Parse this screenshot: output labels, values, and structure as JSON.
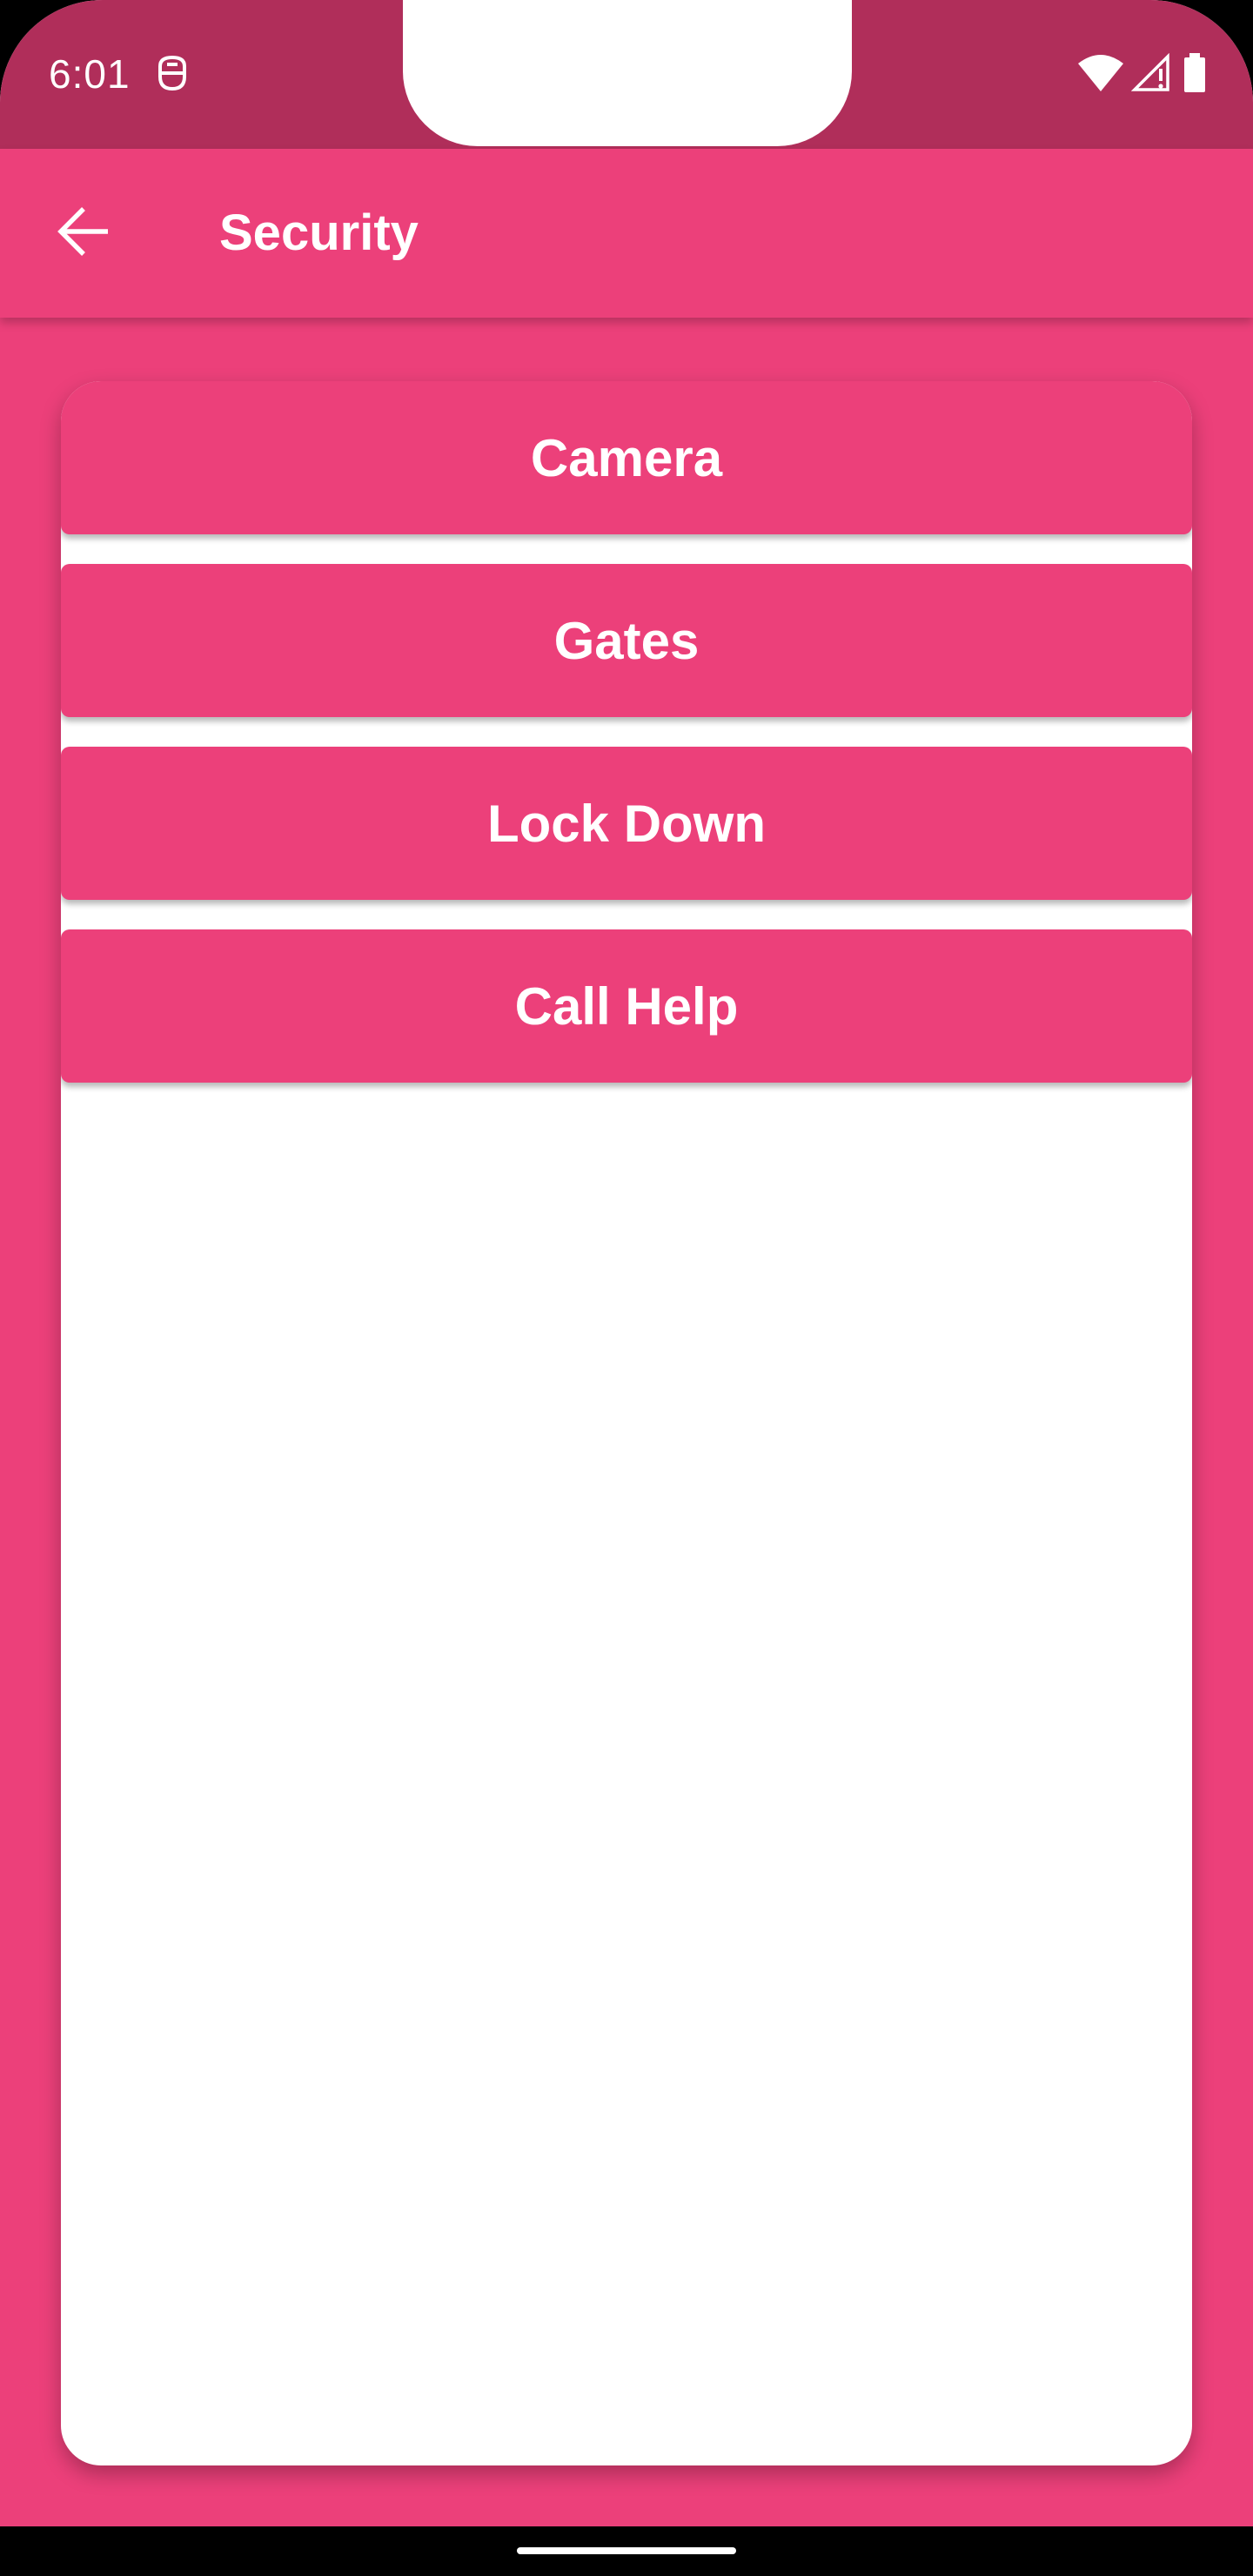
{
  "status_bar": {
    "time": "6:01",
    "icons": [
      "dnd-icon",
      "wifi-icon",
      "signal-icon",
      "battery-icon"
    ]
  },
  "app_bar": {
    "back_icon": "arrow-back-icon",
    "title": "Security"
  },
  "menu": {
    "items": [
      {
        "label": "Camera"
      },
      {
        "label": "Gates"
      },
      {
        "label": "Lock Down"
      },
      {
        "label": "Call Help"
      }
    ]
  },
  "colors": {
    "primary": "#ec407a",
    "primary_dark": "#b02e5a",
    "surface": "#ffffff",
    "on_primary": "#ffffff"
  }
}
